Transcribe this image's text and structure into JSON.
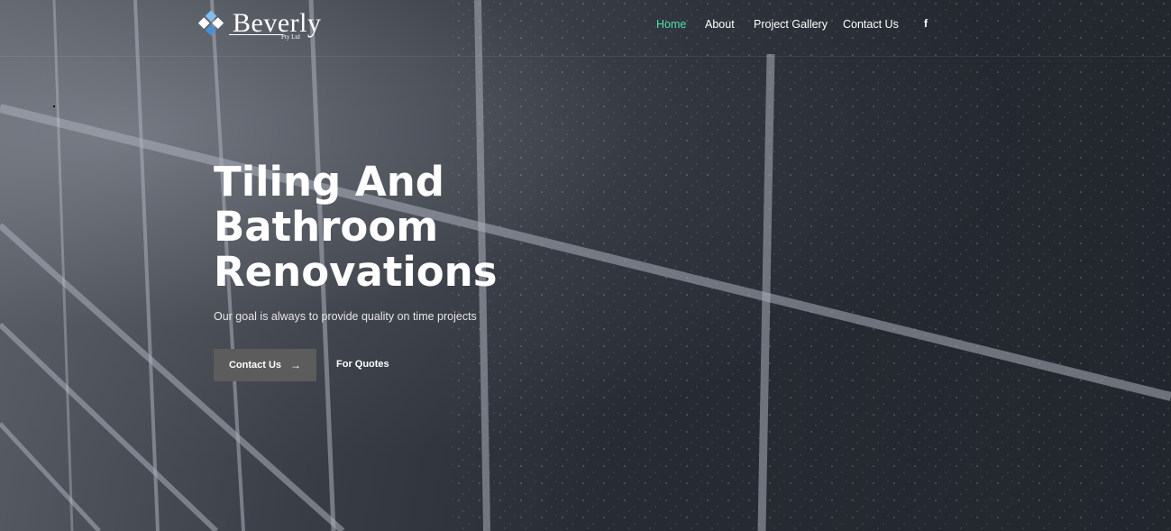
{
  "brand": {
    "name": "Beverly",
    "suffix": "Pty Ltd"
  },
  "nav": {
    "items": [
      {
        "label": "Home",
        "active": true
      },
      {
        "label": "About",
        "active": false
      },
      {
        "label": "Project Gallery",
        "active": false
      },
      {
        "label": "Contact Us",
        "active": false
      }
    ],
    "social": {
      "facebook_glyph": "f",
      "icon": "facebook-icon"
    }
  },
  "hero": {
    "headline": [
      "Tiling And",
      "Bathroom",
      "Renovations"
    ],
    "tagline": "Our goal is always to provide quality on time projects",
    "primary_button": {
      "label": "Contact Us",
      "icon": "arrow-right-icon",
      "glyph": "→"
    },
    "secondary_link": {
      "label": "For Quotes"
    }
  },
  "colors": {
    "accent": "#4ee3b0",
    "button_bg": "#5c5c5c",
    "text": "#ffffff",
    "logo_blue": "#5aa7e6"
  }
}
